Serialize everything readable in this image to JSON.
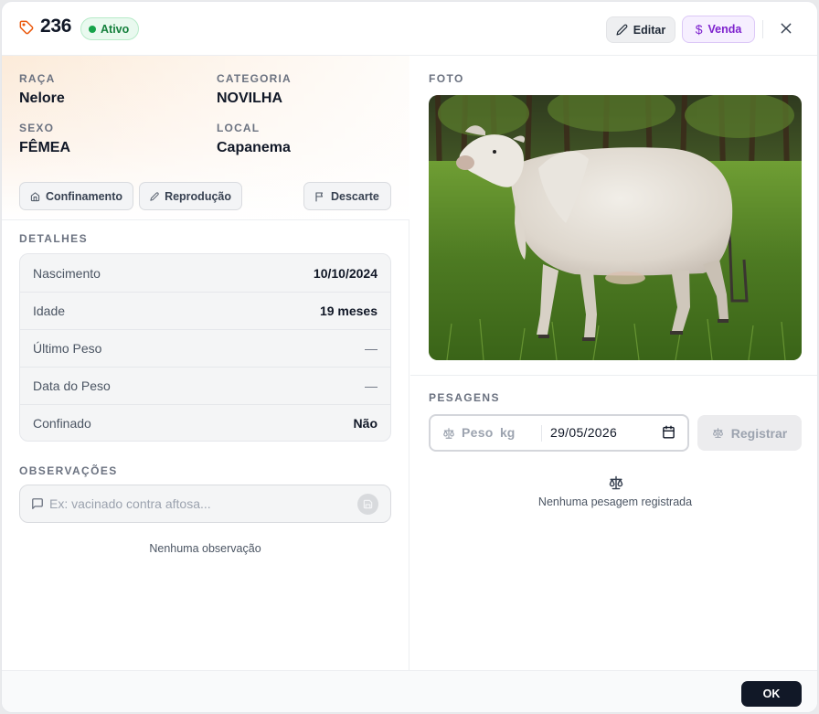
{
  "header": {
    "title": "236",
    "status": "Ativo",
    "edit_label": "Editar",
    "sale_label": "Venda",
    "sale_symbol": "$"
  },
  "info": {
    "breed_label": "RAÇA",
    "breed_value": "Nelore",
    "category_label": "CATEGORIA",
    "category_value": "NOVILHA",
    "sex_label": "SEXO",
    "sex_value": "FÊMEA",
    "location_label": "LOCAL",
    "location_value": "Capanema"
  },
  "actions": {
    "confinement": "Confinamento",
    "reproduction": "Reprodução",
    "discard": "Descarte"
  },
  "details": {
    "title": "DETALHES",
    "rows": [
      {
        "label": "Nascimento",
        "value": "10/10/2024"
      },
      {
        "label": "Idade",
        "value": "19 meses"
      },
      {
        "label": "Último Peso",
        "value": "—"
      },
      {
        "label": "Data do Peso",
        "value": "—"
      },
      {
        "label": "Confinado",
        "value": "Não"
      }
    ]
  },
  "observations": {
    "title": "OBSERVAÇÕES",
    "placeholder": "Ex: vacinado contra aftosa...",
    "empty": "Nenhuma observação"
  },
  "photo": {
    "title": "FOTO"
  },
  "weighings": {
    "title": "PESAGENS",
    "weight_placeholder": "Peso",
    "unit": "kg",
    "date": "29/05/2026",
    "register_label": "Registrar",
    "empty": "Nenhuma pesagem registrada"
  },
  "footer": {
    "ok_label": "OK"
  },
  "colors": {
    "accent_orange": "#ea580c",
    "status_green": "#16a34a",
    "sale_purple": "#7e22ce"
  },
  "icons": [
    "tag-icon",
    "pencil-icon",
    "dollar-icon",
    "close-icon",
    "home-icon",
    "pencil-icon",
    "flag-icon",
    "message-icon",
    "save-icon",
    "scale-icon",
    "calendar-icon"
  ]
}
